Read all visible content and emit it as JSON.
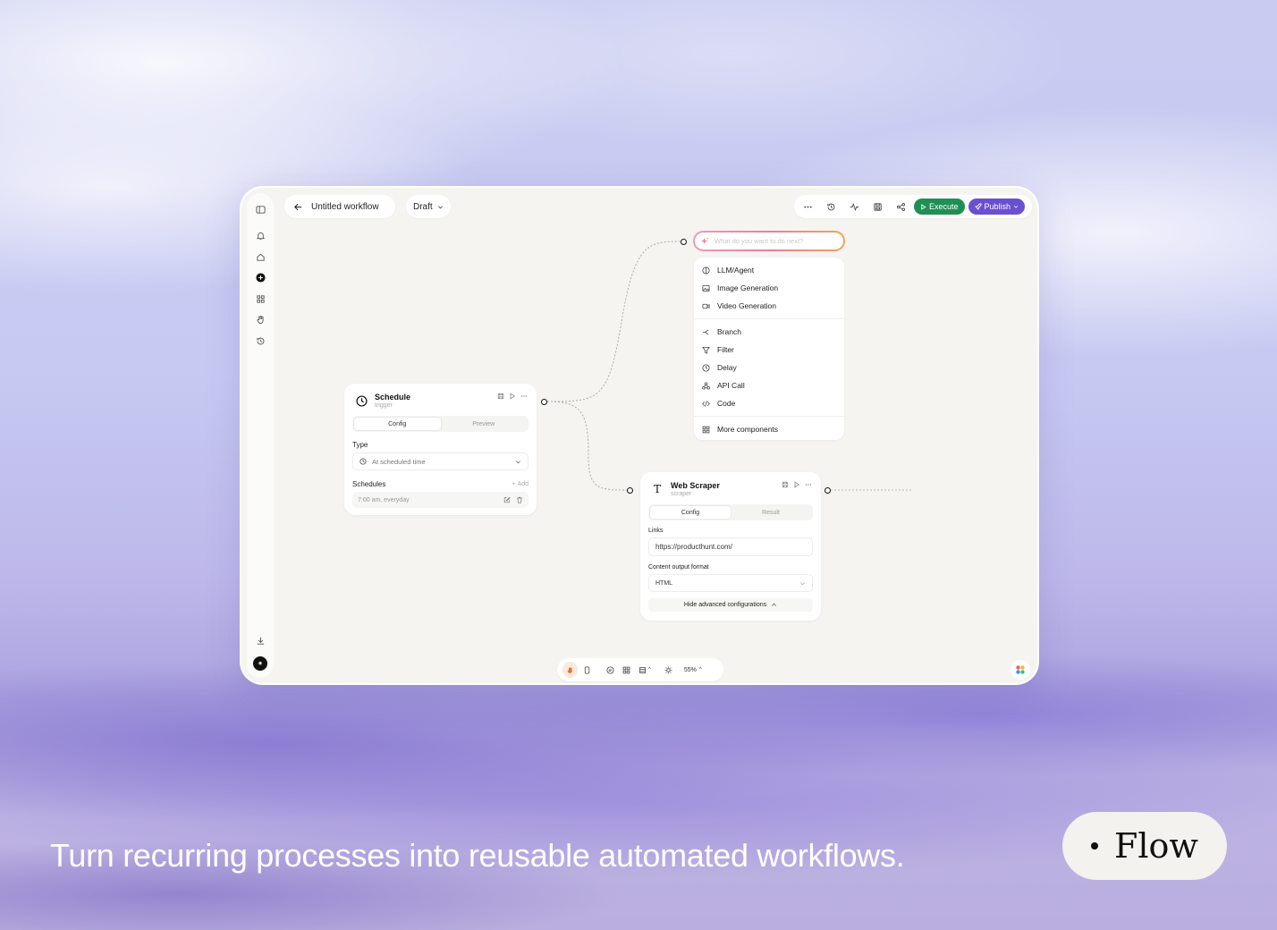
{
  "topbar": {
    "back_label": "Untitled workflow",
    "status_label": "Draft",
    "execute_label": "Execute",
    "publish_label": "Publish"
  },
  "prompt": {
    "placeholder": "What do you want to do next?"
  },
  "component_menu": {
    "group1": [
      {
        "icon": "llm-icon",
        "label": "LLM/Agent"
      },
      {
        "icon": "image-icon",
        "label": "Image Generation"
      },
      {
        "icon": "video-icon",
        "label": "Video Generation"
      }
    ],
    "group2": [
      {
        "icon": "branch-icon",
        "label": "Branch"
      },
      {
        "icon": "filter-icon",
        "label": "Filter"
      },
      {
        "icon": "clock-icon",
        "label": "Delay"
      },
      {
        "icon": "api-icon",
        "label": "API Call"
      },
      {
        "icon": "code-icon",
        "label": "Code"
      }
    ],
    "more_label": "More components"
  },
  "schedule_node": {
    "title": "Schedule",
    "subtitle": "trigger",
    "tabs": [
      "Config",
      "Preview"
    ],
    "type_label": "Type",
    "type_value": "At scheduled time",
    "schedules_label": "Schedules",
    "add_label": "Add",
    "schedule_entry": "7:00 am, everyday"
  },
  "scraper_node": {
    "title": "Web Scraper",
    "subtitle": "scraper",
    "tabs": [
      "Config",
      "Result"
    ],
    "links_label": "Links",
    "links_value": "https://producthunt.com/",
    "format_label": "Content output format",
    "format_value": "HTML",
    "advanced_label": "Hide advanced configurations"
  },
  "bottom_toolbar": {
    "zoom": "55%"
  },
  "tagline": "Turn recurring processes into reusable automated workflows.",
  "badge": "Flow",
  "colors": {
    "execute": "#1e8f55",
    "publish": "#6a4fd0",
    "canvas": "#f5f4f1"
  }
}
